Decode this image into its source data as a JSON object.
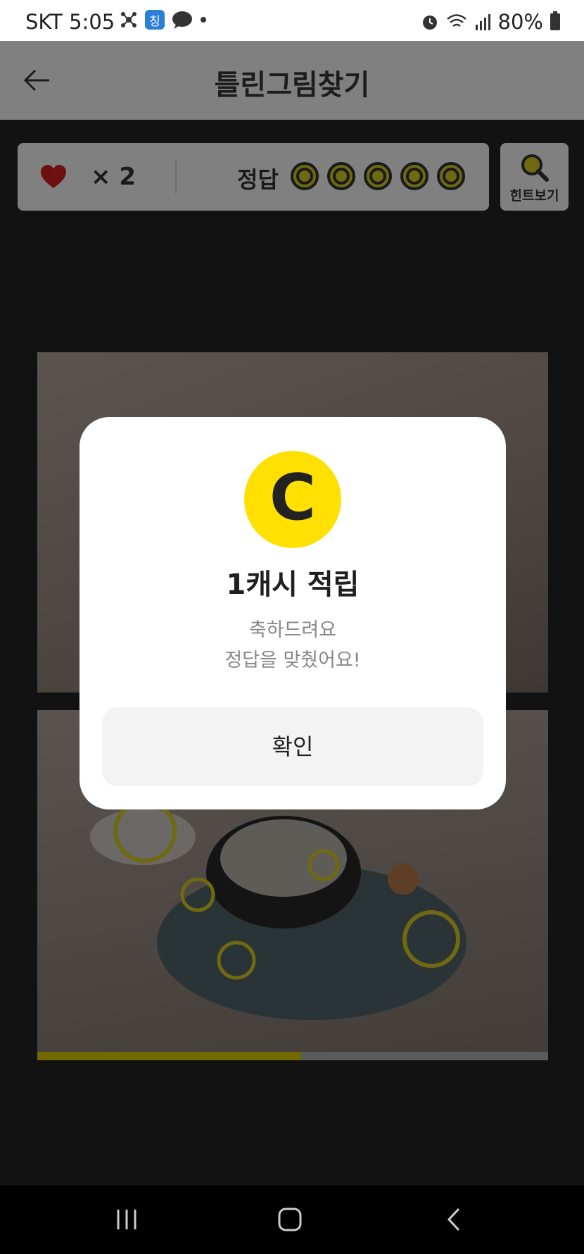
{
  "status_bar": {
    "carrier_time": "SKT 5:05",
    "app_badge": "칭",
    "battery": "80%"
  },
  "header": {
    "title": "틀린그림찾기"
  },
  "scorebar": {
    "lives_text": "× 2",
    "answer_label": "정답",
    "answers_total": 5,
    "answers_found": 0
  },
  "hint_button": {
    "label": "힌트보기"
  },
  "progress": {
    "fraction": 0.516
  },
  "modal": {
    "coin_letter": "C",
    "title": "1캐시 적립",
    "message_line1": "축하드려요",
    "message_line2": "정답을 맞췄어요!",
    "confirm_label": "확인"
  },
  "colors": {
    "coin": "#ffe000",
    "accent_yellow": "#d8cc00",
    "heart": "#d02020"
  }
}
